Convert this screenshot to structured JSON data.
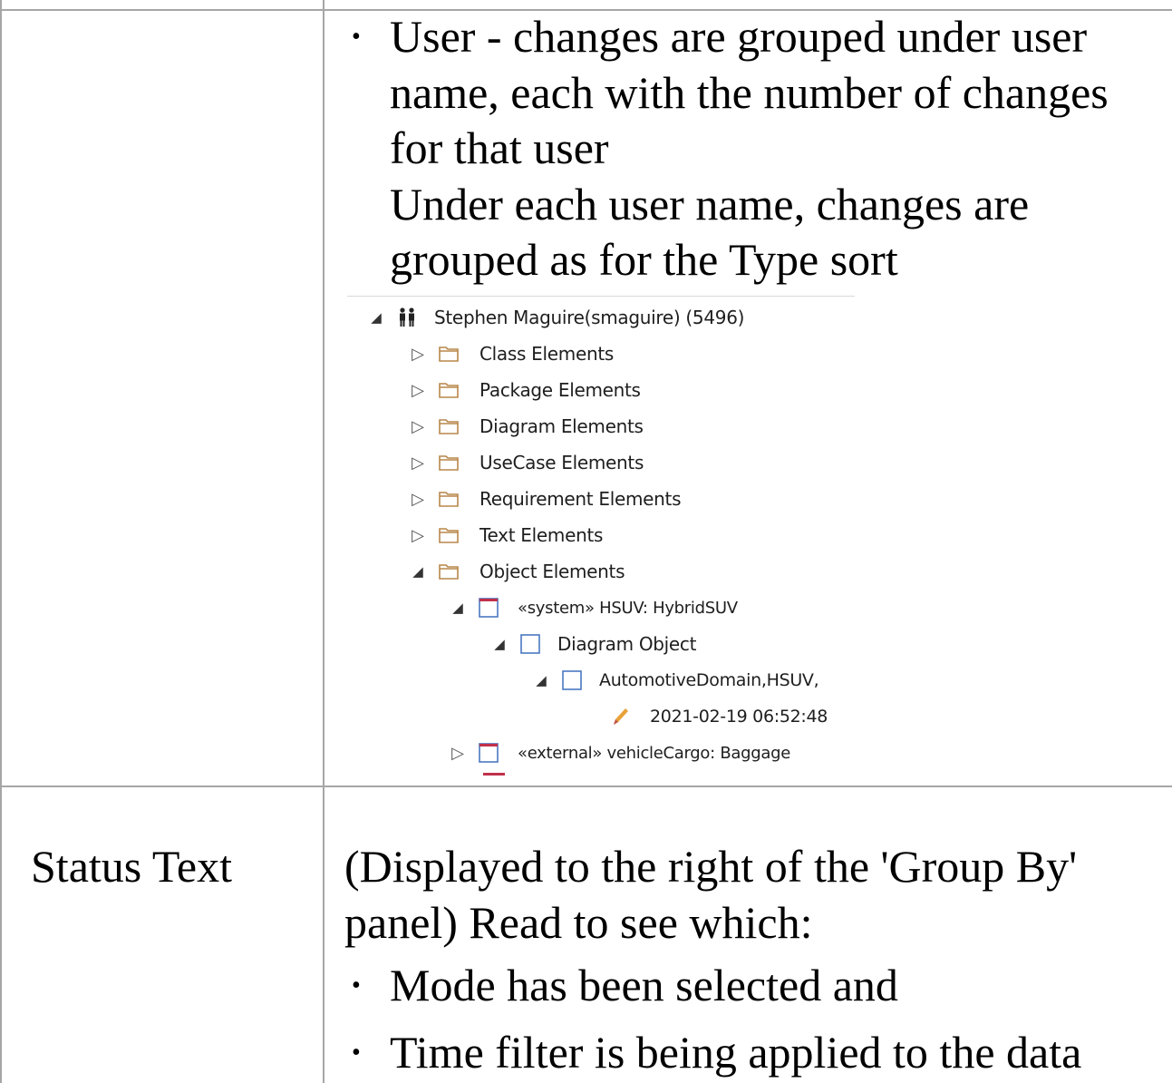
{
  "row1": {
    "bullet_user": {
      "lines": [
        "User - changes are grouped under user",
        "name, each with the number of changes",
        "for that user",
        "Under each user name, changes are",
        "grouped as for the Type sort"
      ]
    },
    "tree": {
      "root": "Stephen Maguire(smaguire) (5496)",
      "folders": [
        "Class Elements",
        "Package Elements",
        "Diagram Elements",
        "UseCase Elements",
        "Requirement Elements",
        "Text Elements",
        "Object Elements"
      ],
      "system_object": "«system» HSUV: HybridSUV",
      "diagram_object": "Diagram Object",
      "automotive": "AutomotiveDomain,HSUV,",
      "timestamp": "2021-02-19 06:52:48",
      "external_object": "«external» vehicleCargo: Baggage"
    }
  },
  "row2": {
    "term": "Status Text",
    "desc_lines": [
      "(Displayed to the right of the 'Group By'",
      "panel) Read to see which:"
    ],
    "bullets": [
      "Mode has been selected and",
      "Time filter is being applied to the data"
    ]
  }
}
